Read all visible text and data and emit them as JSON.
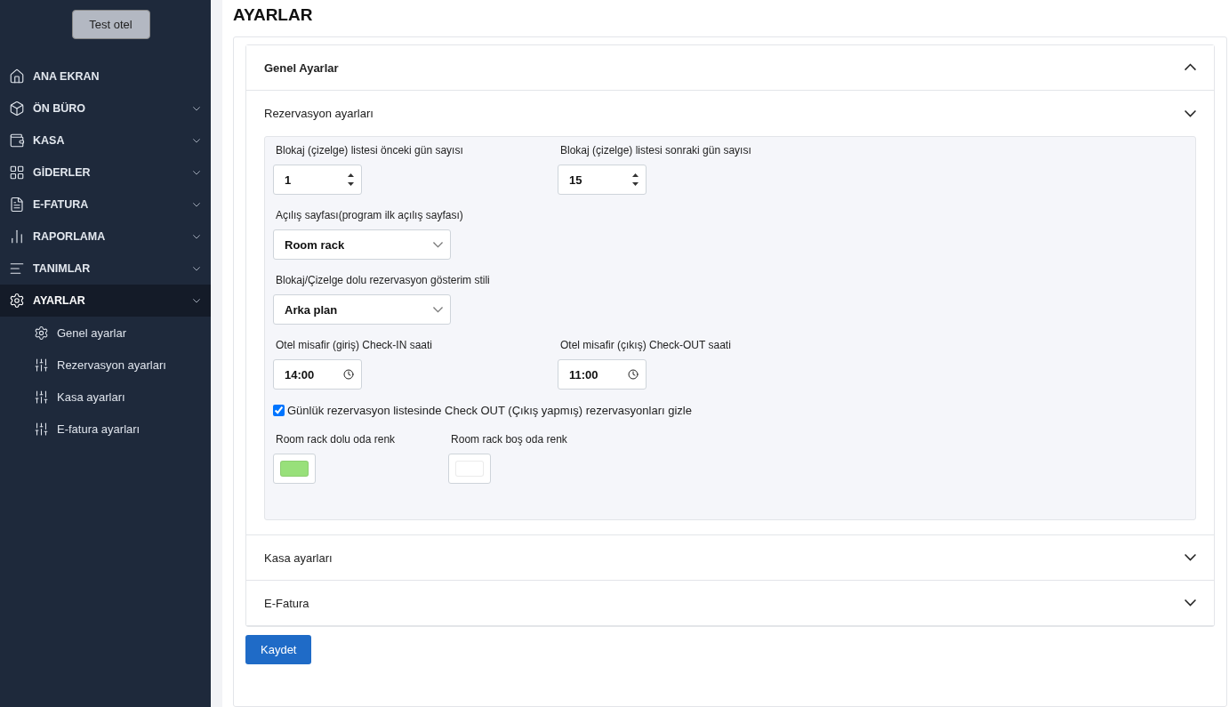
{
  "sidebar": {
    "hotel_button": "Test otel",
    "items": [
      {
        "label": "ANA EKRAN",
        "has_caret": false,
        "expanded": false
      },
      {
        "label": "ÖN BÜRO",
        "has_caret": true,
        "expanded": false
      },
      {
        "label": "KASA",
        "has_caret": true,
        "expanded": false
      },
      {
        "label": "GİDERLER",
        "has_caret": true,
        "expanded": false
      },
      {
        "label": "E-FATURA",
        "has_caret": true,
        "expanded": false
      },
      {
        "label": "RAPORLAMA",
        "has_caret": true,
        "expanded": false
      },
      {
        "label": "TANIMLAR",
        "has_caret": true,
        "expanded": false
      },
      {
        "label": "AYARLAR",
        "has_caret": true,
        "expanded": true,
        "children": [
          {
            "label": "Genel ayarlar"
          },
          {
            "label": "Rezervasyon ayarları"
          },
          {
            "label": "Kasa ayarları"
          },
          {
            "label": "E-fatura ayarları"
          }
        ]
      }
    ]
  },
  "page_title": "AYARLAR",
  "accordion": {
    "title": "Genel Ayarlar",
    "expanded": true,
    "sections": [
      {
        "title": "Rezervasyon ayarları",
        "expanded": true,
        "rows": [
          {
            "fields": [
              {
                "kind": "number",
                "label": "Blokaj (çizelge) listesi önceki gün sayısı",
                "value": "1"
              },
              {
                "kind": "number",
                "label": "Blokaj (çizelge) listesi sonraki gün sayısı",
                "value": "15"
              }
            ]
          },
          {
            "fields": [
              {
                "kind": "select",
                "label": "Açılış sayfası(program ilk açılış sayfası)",
                "value": "Room rack"
              }
            ]
          },
          {
            "fields": [
              {
                "kind": "select",
                "label": "Blokaj/Çizelge dolu rezervasyon gösterim stili",
                "value": "Arka plan"
              }
            ]
          },
          {
            "fields": [
              {
                "kind": "time",
                "label": "Otel misafir (giriş) Check-IN saati",
                "value": "14:00"
              },
              {
                "kind": "time",
                "label": "Otel misafir (çıkış) Check-OUT saati",
                "value": "11:00"
              }
            ]
          },
          {
            "fields": [
              {
                "kind": "checkbox",
                "label": "Günlük rezervasyon listesinde Check OUT (Çıkış yapmış) rezervasyonları gizle",
                "checked": true
              }
            ]
          },
          {
            "fields": [
              {
                "kind": "color",
                "label": "Room rack dolu oda renk",
                "color": "#98e07a"
              },
              {
                "kind": "color",
                "label": "Room rack boş oda renk",
                "color": "#ffffff"
              }
            ]
          }
        ]
      },
      {
        "title": "Kasa ayarları",
        "expanded": false
      },
      {
        "title": "E-Fatura",
        "expanded": false
      }
    ]
  },
  "save_button": "Kaydet"
}
